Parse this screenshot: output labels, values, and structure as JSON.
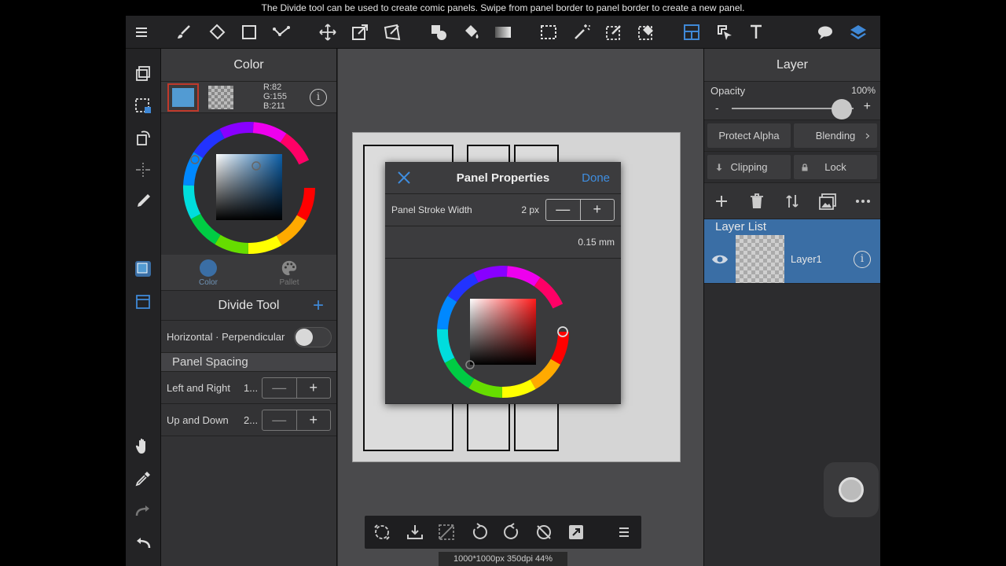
{
  "hint": "The Divide tool can be used to create comic panels. Swipe from panel border to panel border to create a new panel.",
  "color_panel": {
    "title": "Color",
    "rgb": {
      "r": "R:82",
      "g": "G:155",
      "b": "B:211"
    },
    "info_glyph": "i",
    "fg_color": "#529bd3",
    "tabs": [
      {
        "label": "Color"
      },
      {
        "label": "Pallet"
      }
    ]
  },
  "divide_tool": {
    "title": "Divide Tool",
    "plus": "+",
    "toggle_label": "Horizontal · Perpendicular",
    "section": "Panel Spacing",
    "rows": [
      {
        "label": "Left and Right",
        "value": "1..."
      },
      {
        "label": "Up and Down",
        "value": "2..."
      }
    ],
    "minus": "—",
    "plus_glyph": "+"
  },
  "dialog": {
    "title": "Panel Properties",
    "done": "Done",
    "stroke_label": "Panel Stroke Width",
    "stroke_value": "2 px",
    "stroke_mm": "0.15 mm",
    "minus": "—",
    "plus": "+"
  },
  "layer_panel": {
    "title": "Layer",
    "opacity_label": "Opacity",
    "opacity_value": "100%",
    "opacity_fraction": 1.0,
    "minus": "-",
    "plus": "+",
    "protect_alpha": "Protect Alpha",
    "blending": "Blending",
    "clipping": "Clipping",
    "lock": "Lock",
    "list_title": "Layer List",
    "layers": [
      {
        "name": "Layer1"
      }
    ],
    "info_glyph": "i"
  },
  "status": "1000*1000px 350dpi 44%",
  "colors": {
    "accent": "#3f8ee0",
    "selection": "#3a6ea5"
  }
}
